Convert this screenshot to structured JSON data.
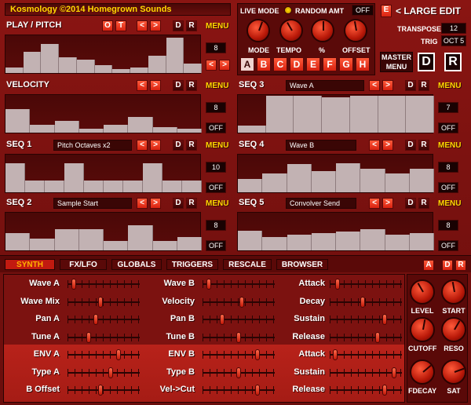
{
  "header": {
    "brand": "Kosmology ©2014 Homegrown Sounds",
    "live_mode": "LIVE MODE",
    "random_amt": "RANDOM AMT",
    "random_val": "OFF",
    "e": "E",
    "large_edit": "< LARGE EDIT",
    "transpose_label": "TRANSPOSE",
    "transpose_val": "12",
    "trig_label": "TRIG",
    "trig_val": "OCT 5",
    "master": "MASTER",
    "menu": "MENU",
    "knobs": [
      "MODE",
      "TEMPO",
      "%",
      "OFFSET"
    ],
    "scenes": [
      "A",
      "B",
      "C",
      "D",
      "E",
      "F",
      "G",
      "H"
    ]
  },
  "seq": {
    "play": {
      "title": "PLAY / PITCH",
      "o": "O",
      "t": "T",
      "menu": "MENU",
      "val": "8",
      "bars": [
        0.15,
        0.55,
        0.75,
        0.4,
        0.35,
        0.2,
        0.1,
        0.15,
        0.45,
        0.9,
        0.25
      ]
    },
    "velocity": {
      "title": "VELOCITY",
      "menu": "MENU",
      "val": "8",
      "off": "OFF",
      "bars": [
        0.6,
        0.2,
        0.3,
        0.1,
        0.2,
        0.4,
        0.15,
        0.1
      ]
    },
    "seq1": {
      "title": "SEQ 1",
      "dd": "Pitch Octaves x2",
      "menu": "MENU",
      "val": "10",
      "off": "OFF",
      "bars": [
        0.75,
        0.3,
        0.3,
        0.75,
        0.3,
        0.3,
        0.3,
        0.75,
        0.3,
        0.3
      ]
    },
    "seq2": {
      "title": "SEQ 2",
      "dd": "Sample Start",
      "menu": "MENU",
      "val": "8",
      "off": "OFF",
      "bars": [
        0.45,
        0.3,
        0.55,
        0.55,
        0.25,
        0.65,
        0.25,
        0.35
      ]
    },
    "seq3": {
      "title": "SEQ 3",
      "dd": "Wave A",
      "menu": "MENU",
      "val": "7",
      "off": "OFF",
      "bars": [
        0.18,
        0.95,
        0.95,
        0.9,
        0.95,
        0.95,
        0.95
      ]
    },
    "seq4": {
      "title": "SEQ 4",
      "dd": "Wave B",
      "menu": "MENU",
      "val": "8",
      "off": "OFF",
      "bars": [
        0.35,
        0.48,
        0.72,
        0.55,
        0.75,
        0.6,
        0.48,
        0.6
      ]
    },
    "seq5": {
      "title": "SEQ 5",
      "dd": "Convolver Send",
      "menu": "MENU",
      "val": "8",
      "off": "OFF",
      "bars": [
        0.5,
        0.35,
        0.4,
        0.45,
        0.48,
        0.55,
        0.4,
        0.45
      ]
    }
  },
  "tabs": [
    "SYNTH",
    "FX/LFO",
    "GLOBALS",
    "TRIGGERS",
    "RESCALE",
    "BROWSER"
  ],
  "corner": {
    "a": "A",
    "d": "D",
    "r": "R"
  },
  "params": {
    "col1": [
      {
        "label": "Wave A",
        "v": 0.06
      },
      {
        "label": "Wave Mix",
        "v": 0.45
      },
      {
        "label": "Pan A",
        "v": 0.38
      },
      {
        "label": "Tune A",
        "v": 0.28
      },
      {
        "label": "ENV A",
        "v": 0.72
      },
      {
        "label": "Type A",
        "v": 0.6
      },
      {
        "label": "B Offset",
        "v": 0.45
      }
    ],
    "col2": [
      {
        "label": "Wave B",
        "v": 0.06
      },
      {
        "label": "Velocity",
        "v": 0.55
      },
      {
        "label": "Pan B",
        "v": 0.25
      },
      {
        "label": "Tune B",
        "v": 0.5
      },
      {
        "label": "ENV B",
        "v": 0.78
      },
      {
        "label": "Type B",
        "v": 0.5
      },
      {
        "label": "Vel->Cut",
        "v": 0.78
      }
    ],
    "col3": [
      {
        "label": "Attack",
        "v": 0.08
      },
      {
        "label": "Decay",
        "v": 0.45
      },
      {
        "label": "Sustain",
        "v": 0.78
      },
      {
        "label": "Release",
        "v": 0.68
      },
      {
        "label": "Attack",
        "v": 0.05
      },
      {
        "label": "Sustain",
        "v": 0.92
      },
      {
        "label": "Release",
        "v": 0.78
      }
    ]
  },
  "knobs": [
    "LEVEL",
    "START",
    "CUTOFF",
    "RESO",
    "FDECAY",
    "SAT"
  ],
  "arrows": {
    "left": "<",
    "right": ">",
    "d": "D",
    "r": "R"
  }
}
